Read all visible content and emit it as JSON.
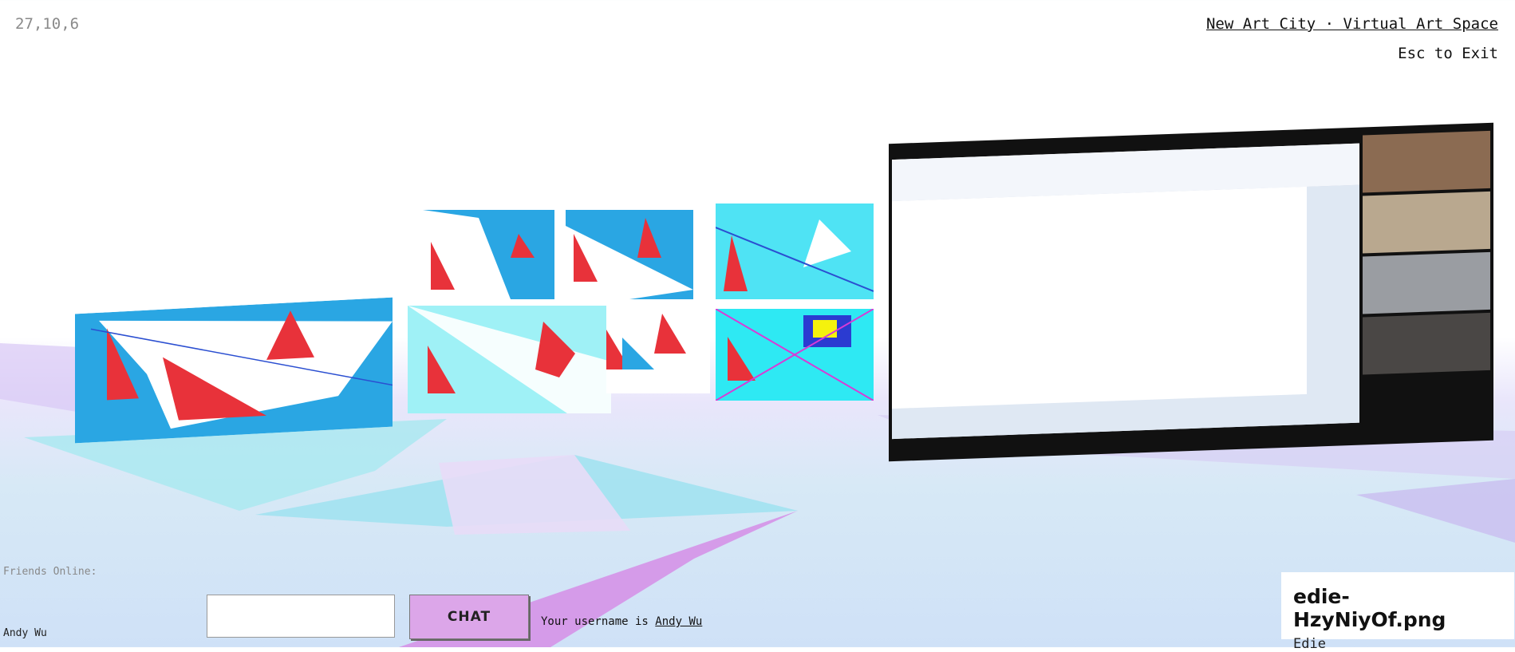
{
  "hud": {
    "coordinates": "27,10,6",
    "site_link": "New Art City · Virtual Art Space",
    "exit_hint": "Esc to Exit"
  },
  "friends": {
    "label": "Friends Online:",
    "names": [
      "Andy Wu"
    ]
  },
  "chat": {
    "input_value": "",
    "button_label": "CHAT",
    "username_prefix": "Your username is ",
    "username": "Andy Wu"
  },
  "selected_artwork": {
    "filename": "edie-HzyNiyOf.png",
    "artist": "Edie"
  },
  "colors": {
    "accent_blue": "#2aa6e3",
    "accent_red": "#e8323a",
    "cyan": "#4fe3f4",
    "floor_pink": "#d59be9",
    "floor_cyan": "#9fe7f2",
    "chat_button": "#dca6e9"
  }
}
